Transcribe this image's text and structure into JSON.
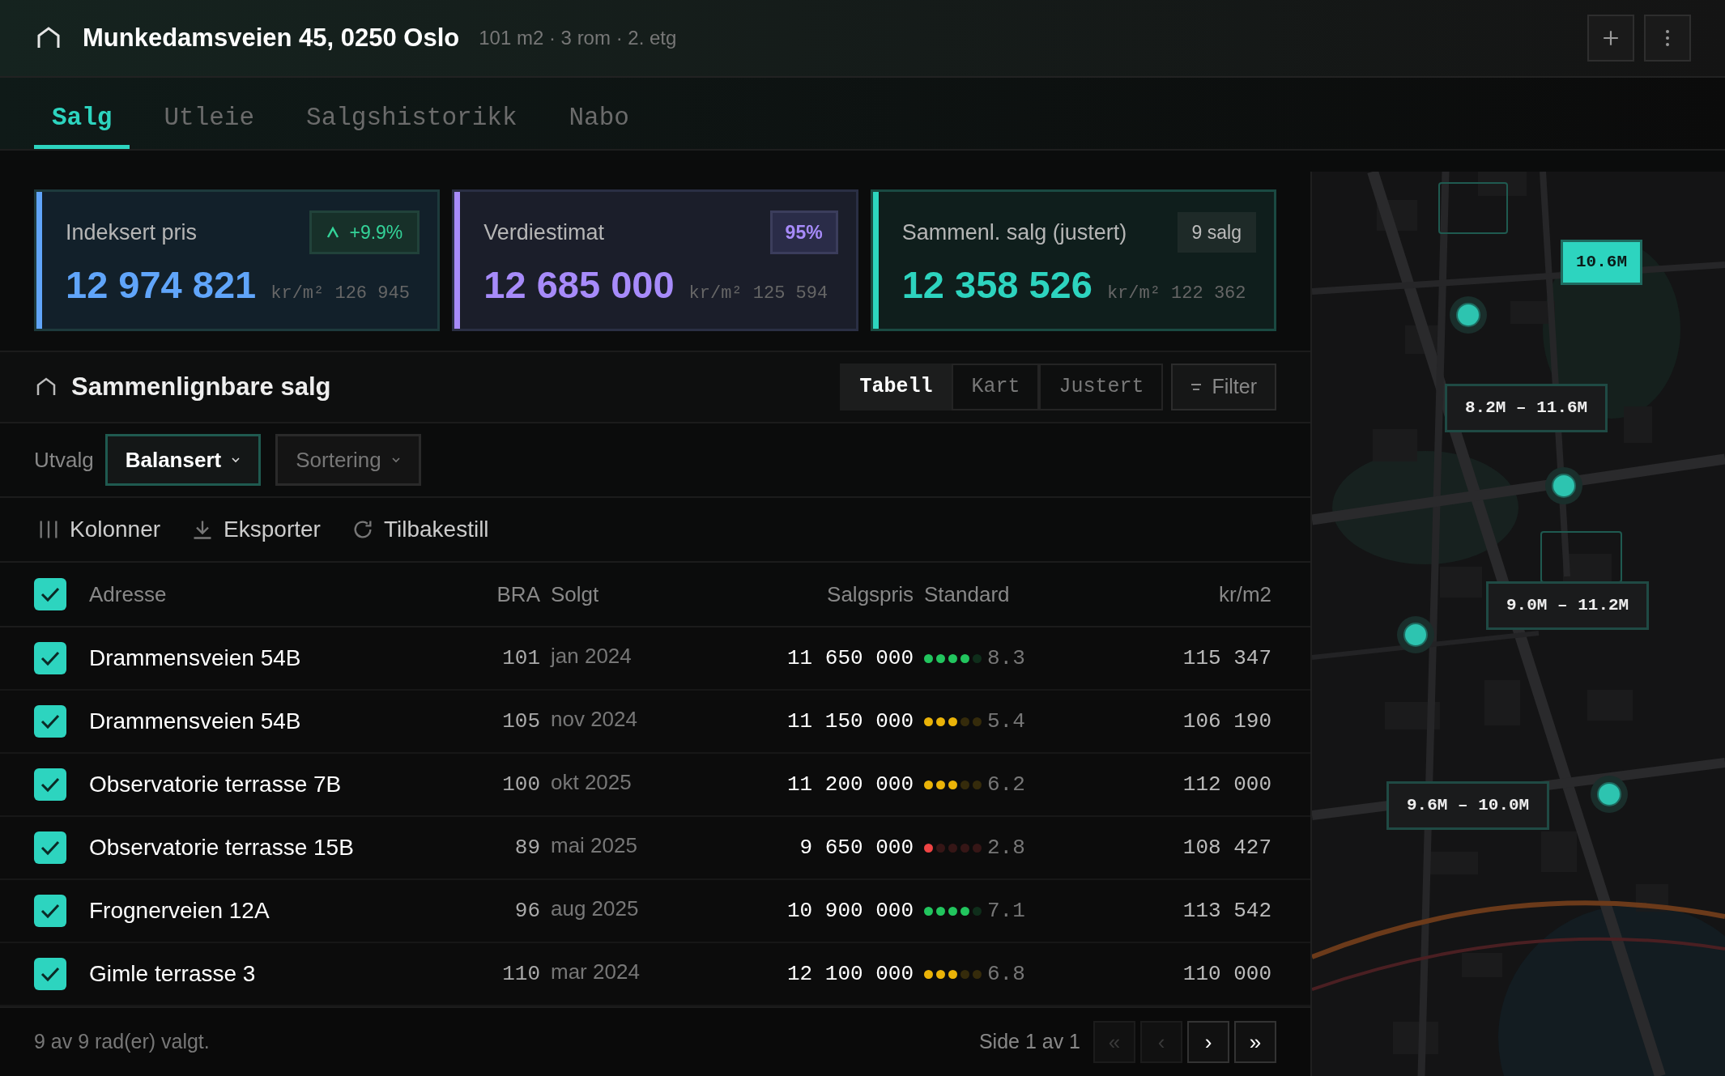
{
  "header": {
    "title": "Munkedamsveien 45, 0250 Oslo",
    "subtitle": "101 m2 · 3 rom · 2. etg"
  },
  "tabs": [
    {
      "label": "Salg",
      "selected": true
    },
    {
      "label": "Utleie",
      "selected": false
    },
    {
      "label": "Salgshistorikk",
      "selected": false
    },
    {
      "label": "Nabo",
      "selected": false
    }
  ],
  "cards": [
    {
      "label": "Indeksert pris",
      "value": "12 974 821",
      "unit": "kr/m²",
      "per_m2": "126 945",
      "color": "#60a5fa",
      "badge": {
        "text": "+9.9%",
        "kind": "trend"
      }
    },
    {
      "label": "Verdiestimat",
      "value": "12 685 000",
      "unit": "kr/m²",
      "per_m2": "125 594",
      "color": "#a78bfa",
      "badge": {
        "text": "95%",
        "kind": "confidence"
      }
    },
    {
      "label": "Sammenl. salg (justert)",
      "value": "12 358 526",
      "unit": "kr/m²",
      "per_m2": "122 362",
      "color": "#2dd4bf",
      "badge": {
        "text": "9 salg",
        "kind": "count"
      }
    }
  ],
  "section": {
    "title": "Sammenlignbare salg",
    "views": [
      {
        "label": "Tabell",
        "selected": true
      },
      {
        "label": "Kart",
        "selected": false
      },
      {
        "label": "Justert",
        "selected": false
      }
    ],
    "filter_button": "Filter"
  },
  "selection": {
    "label": "Utvalg",
    "dropdowns": [
      {
        "label": "Balansert",
        "selected": true
      },
      {
        "label": "Sortering",
        "selected": false
      }
    ]
  },
  "toolbar": [
    {
      "label": "Kolonner",
      "kind": "columns"
    },
    {
      "label": "Eksporter",
      "kind": "export"
    },
    {
      "label": "Tilbakestill",
      "kind": "reset"
    }
  ],
  "table": {
    "select_all": true,
    "columns": [
      "Adresse",
      "BRA",
      "Solgt",
      "Salgspris",
      "Standard",
      "kr/m2"
    ],
    "rows": [
      {
        "checked": true,
        "address": "Drammensveien 54B",
        "bra": "101",
        "sold": "jan 2024",
        "price": "11 650 000",
        "stars": 4,
        "color": "#22c55e",
        "score": "8.3",
        "per_m2": "115 347"
      },
      {
        "checked": true,
        "address": "Drammensveien 54B",
        "bra": "105",
        "sold": "nov 2024",
        "price": "11 150 000",
        "stars": 3,
        "color": "#eab308",
        "score": "5.4",
        "per_m2": "106 190"
      },
      {
        "checked": true,
        "address": "Observatorie terrasse 7B",
        "bra": "100",
        "sold": "okt 2025",
        "price": "11 200 000",
        "stars": 3,
        "color": "#eab308",
        "score": "6.2",
        "per_m2": "112 000"
      },
      {
        "checked": true,
        "address": "Observatorie terrasse 15B",
        "bra": "89",
        "sold": "mai 2025",
        "price": "9 650 000",
        "stars": 1,
        "color": "#ef4444",
        "score": "2.8",
        "per_m2": "108 427"
      },
      {
        "checked": true,
        "address": "Frognerveien 12A",
        "bra": "96",
        "sold": "aug 2025",
        "price": "10 900 000",
        "stars": 4,
        "color": "#22c55e",
        "score": "7.1",
        "per_m2": "113 542"
      },
      {
        "checked": true,
        "address": "Gimle terrasse 3",
        "bra": "110",
        "sold": "mar 2024",
        "price": "12 100 000",
        "stars": 3,
        "color": "#eab308",
        "score": "6.8",
        "per_m2": "110 000"
      }
    ]
  },
  "footer": {
    "selection": "9 av 9 rad(er) valgt.",
    "page": "Side 1 av 1",
    "pager": [
      {
        "label": "«",
        "disabled": true
      },
      {
        "label": "‹",
        "disabled": true
      },
      {
        "label": "›",
        "disabled": false
      },
      {
        "label": "»",
        "disabled": false
      }
    ]
  },
  "map": {
    "labels": [
      {
        "text": "10.6M",
        "selected": true
      },
      {
        "text": "8.2M – 11.6M",
        "selected": false
      },
      {
        "text": "9.0M – 11.2M",
        "selected": false
      },
      {
        "text": "9.6M – 10.0M",
        "selected": false
      }
    ]
  }
}
